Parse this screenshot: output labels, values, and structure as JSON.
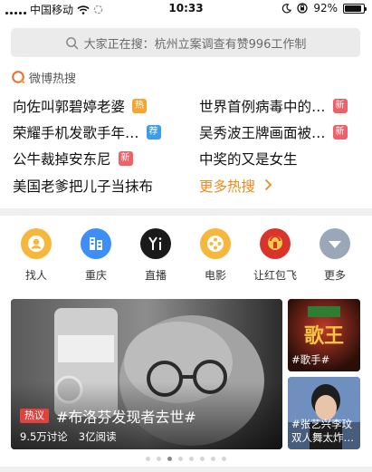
{
  "status_bar": {
    "carrier": "中国移动",
    "time": "10:33",
    "battery": "92%",
    "battery_level": 0.92
  },
  "search": {
    "placeholder": "大家正在搜：杭州立案调查有赞996工作制"
  },
  "hot": {
    "section_title": "微博热搜",
    "left": [
      {
        "text": "向佐叫郭碧婷老婆",
        "badge": "热",
        "badge_type": "hot"
      },
      {
        "text": "荣耀手机发歌手年…",
        "badge": "荐",
        "badge_type": "recommend"
      },
      {
        "text": "公牛裁掉安东尼",
        "badge": "新",
        "badge_type": "new"
      },
      {
        "text": "美国老爹把儿子当抹布",
        "badge": "",
        "badge_type": ""
      }
    ],
    "right": [
      {
        "text": "世界首例病毒中的…",
        "badge": "新",
        "badge_type": "new"
      },
      {
        "text": "吴秀波王牌画面被…",
        "badge": "新",
        "badge_type": "new"
      },
      {
        "text": "中奖的又是女生",
        "badge": "",
        "badge_type": ""
      }
    ],
    "more_label": "更多热搜",
    "colors": {
      "hot": "#f7a531",
      "new": "#f06068",
      "recommend": "#3b9cf0",
      "more": "#f08a1c"
    }
  },
  "shortcuts": [
    {
      "label": "找人",
      "icon": "find-people-icon"
    },
    {
      "label": "重庆",
      "icon": "city-chongqing-icon"
    },
    {
      "label": "直播",
      "icon": "live-yi-icon"
    },
    {
      "label": "电影",
      "icon": "film-reel-icon"
    },
    {
      "label": "让红包飞",
      "icon": "red-envelope-icon"
    },
    {
      "label": "更多",
      "icon": "more-chevron-icon"
    }
  ],
  "banner": {
    "tag": "热议",
    "title": "#布洛芬发现者去世#",
    "discussions": "9.5万讨论",
    "reads": "3亿阅读"
  },
  "side_cards": [
    {
      "caption": "#歌手#",
      "logo_text": "歌王"
    },
    {
      "caption": "#张艺兴李玟双人舞太炸…"
    }
  ],
  "carousel": {
    "count": 8,
    "active": 2
  }
}
